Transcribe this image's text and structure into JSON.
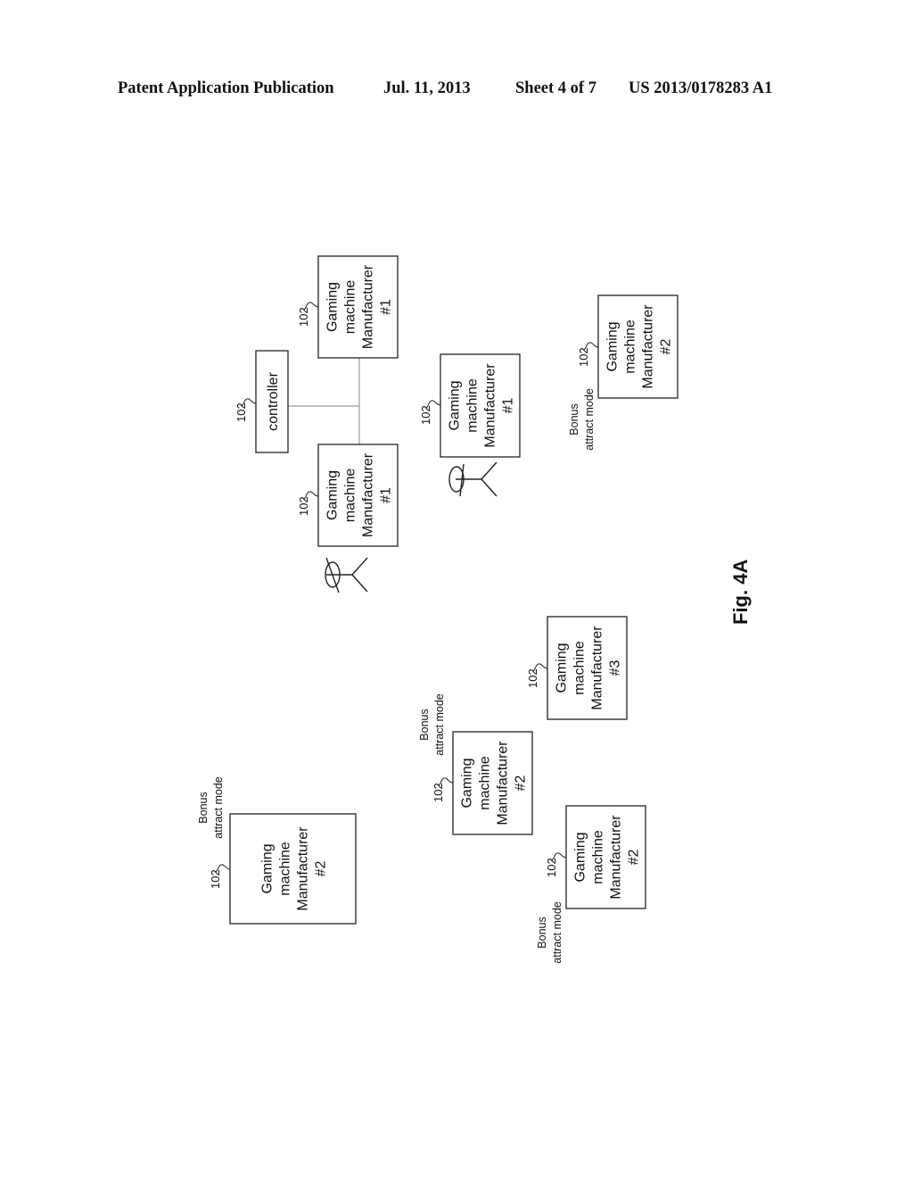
{
  "header": {
    "publication": "Patent Application Publication",
    "date": "Jul. 11, 2013",
    "sheet": "Sheet 4 of 7",
    "number": "US 2013/0178283 A1"
  },
  "figure_label": "Fig. 4A",
  "controller": {
    "label": "controller",
    "ref": "102"
  },
  "machines": [
    {
      "lines": [
        "Gaming",
        "machine",
        "Manufacturer",
        "#1"
      ],
      "ref": "102",
      "note": []
    },
    {
      "lines": [
        "Gaming",
        "machine",
        "Manufacturer",
        "#1"
      ],
      "ref": "102",
      "note": []
    },
    {
      "lines": [
        "Gaming",
        "machine",
        "Manufacturer",
        "#1"
      ],
      "ref": "102",
      "note": []
    },
    {
      "lines": [
        "Gaming",
        "machine",
        "Manufacturer",
        "#2"
      ],
      "ref": "102",
      "note": [
        "Bonus",
        "attract mode"
      ]
    },
    {
      "lines": [
        "Gaming",
        "machine",
        "Manufacturer",
        "#2"
      ],
      "ref": "102",
      "note": [
        "Bonus",
        "attract mode"
      ]
    },
    {
      "lines": [
        "Gaming",
        "machine",
        "Manufacturer",
        "#2"
      ],
      "ref": "102",
      "note": [
        "Bonus",
        "attract mode"
      ]
    },
    {
      "lines": [
        "Gaming",
        "machine",
        "Manufacturer",
        "#3"
      ],
      "ref": "102",
      "note": []
    },
    {
      "lines": [
        "Gaming",
        "machine",
        "Manufacturer",
        "#2"
      ],
      "ref": "102",
      "note": [
        "Bonus",
        "attract mode"
      ]
    }
  ]
}
